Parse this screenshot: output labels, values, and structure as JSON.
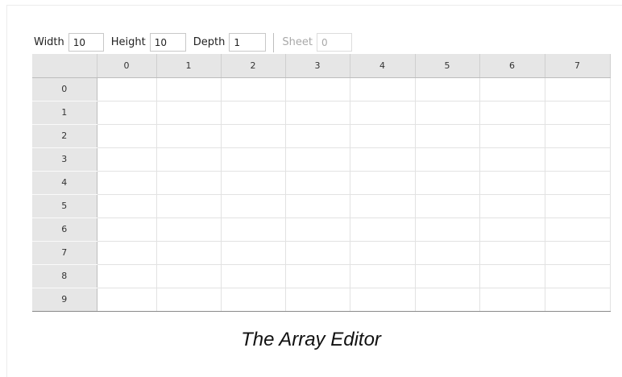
{
  "toolbar": {
    "width_label": "Width",
    "width_value": "10",
    "height_label": "Height",
    "height_value": "10",
    "depth_label": "Depth",
    "depth_value": "1",
    "sheet_label": "Sheet",
    "sheet_value": "0"
  },
  "grid": {
    "column_headers": [
      "0",
      "1",
      "2",
      "3",
      "4",
      "5",
      "6",
      "7"
    ],
    "row_headers": [
      "0",
      "1",
      "2",
      "3",
      "4",
      "5",
      "6",
      "7",
      "8",
      "9"
    ]
  },
  "caption": "The Array Editor"
}
